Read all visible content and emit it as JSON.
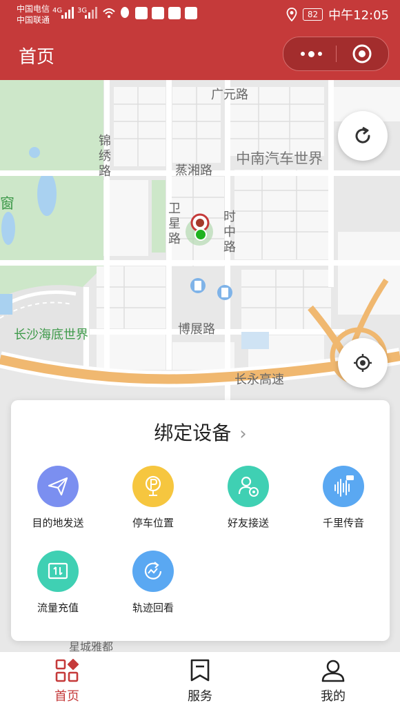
{
  "status_bar": {
    "carrier_1": "中国电信",
    "carrier_2": "中国联通",
    "network_1": "4G",
    "network_2": "3G",
    "battery": "82",
    "time": "中午12:05"
  },
  "header": {
    "title": "首页"
  },
  "map": {
    "labels": {
      "guangyuan_road": "广元路",
      "jinxiu_road": "锦绣路",
      "yanxiang_road": "蒸湘路",
      "zhongnan_auto_world": "中南汽车世界",
      "weixing_road": "卫星路",
      "shizhong_road": "时中路",
      "window": "窗",
      "changsha_underwater_world": "长沙海底世界",
      "bozhan_road": "博展路",
      "changyong_expressway": "长永高速",
      "xingcheng_yadu": "星城雅都"
    }
  },
  "card": {
    "title": "绑定设备",
    "features": [
      {
        "label": "目的地发送",
        "icon": "paper-plane-icon",
        "color": "#7b8ff0"
      },
      {
        "label": "停车位置",
        "icon": "parking-pin-icon",
        "color": "#f6c63f"
      },
      {
        "label": "好友接送",
        "icon": "friend-car-icon",
        "color": "#3fd0b3"
      },
      {
        "label": "千里传音",
        "icon": "voice-wave-icon",
        "color": "#5aa8f2"
      },
      {
        "label": "流量充值",
        "icon": "data-topup-icon",
        "color": "#3fd0b3"
      },
      {
        "label": "轨迹回看",
        "icon": "track-replay-icon",
        "color": "#5aa8f2"
      }
    ]
  },
  "tabbar": {
    "tabs": [
      {
        "label": "首页",
        "icon": "home-grid-icon",
        "active": true
      },
      {
        "label": "服务",
        "icon": "bookmark-icon",
        "active": false
      },
      {
        "label": "我的",
        "icon": "user-icon",
        "active": false
      }
    ]
  },
  "colors": {
    "brand_red": "#c53a3a",
    "map_bg": "#e8e8e8",
    "park_green": "#cde7c9",
    "expressway": "#f0b870"
  }
}
